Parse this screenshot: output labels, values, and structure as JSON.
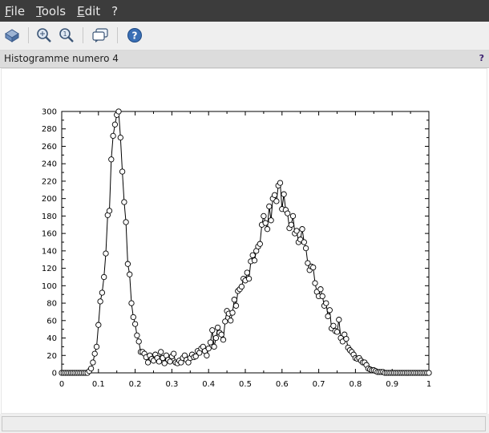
{
  "menu": [
    "File",
    "Tools",
    "Edit",
    "?"
  ],
  "toolbar": {
    "icons": [
      "select-rotate-icon",
      "zoom-icon",
      "zoom-reset-icon",
      "datatip-icon",
      "help-icon"
    ]
  },
  "panel": {
    "title": "Histogramme numero 4",
    "help": "?"
  },
  "chart_data": {
    "type": "line",
    "title": "",
    "xlabel": "",
    "ylabel": "",
    "xlim": [
      0,
      1
    ],
    "ylim": [
      0,
      300
    ],
    "x_ticks": [
      "0",
      "0.1",
      "0.2",
      "0.3",
      "0.4",
      "0.5",
      "0.6",
      "0.7",
      "0.8",
      "0.9",
      "1"
    ],
    "y_ticks": [
      "0",
      "20",
      "40",
      "60",
      "80",
      "100",
      "120",
      "140",
      "160",
      "180",
      "200",
      "220",
      "240",
      "260",
      "280",
      "300"
    ],
    "grid": false,
    "markers": "open-circle",
    "series": [
      {
        "x": [
          0.0,
          0.005,
          0.01,
          0.015,
          0.02,
          0.025,
          0.03,
          0.035,
          0.04,
          0.045,
          0.05,
          0.055,
          0.06,
          0.065,
          0.07,
          0.075,
          0.08,
          0.085,
          0.09,
          0.095,
          0.1,
          0.105,
          0.11,
          0.115,
          0.12,
          0.125,
          0.13,
          0.135,
          0.14,
          0.145,
          0.15,
          0.155,
          0.16,
          0.165,
          0.17,
          0.175,
          0.18,
          0.185,
          0.19,
          0.195,
          0.2,
          0.205,
          0.21,
          0.215,
          0.22,
          0.225,
          0.23,
          0.235,
          0.24,
          0.245,
          0.25,
          0.255,
          0.26,
          0.265,
          0.27,
          0.275,
          0.28,
          0.285,
          0.29,
          0.295,
          0.3,
          0.305,
          0.31,
          0.315,
          0.32,
          0.325,
          0.33,
          0.335,
          0.34,
          0.345,
          0.35,
          0.355,
          0.36,
          0.365,
          0.37,
          0.375,
          0.38,
          0.385,
          0.39,
          0.395,
          0.4,
          0.405,
          0.41,
          0.415,
          0.42,
          0.425,
          0.43,
          0.435,
          0.44,
          0.445,
          0.45,
          0.455,
          0.46,
          0.465,
          0.47,
          0.475,
          0.48,
          0.485,
          0.49,
          0.495,
          0.5,
          0.505,
          0.51,
          0.515,
          0.52,
          0.525,
          0.53,
          0.535,
          0.54,
          0.545,
          0.55,
          0.555,
          0.56,
          0.565,
          0.57,
          0.575,
          0.58,
          0.585,
          0.59,
          0.595,
          0.6,
          0.605,
          0.61,
          0.615,
          0.62,
          0.625,
          0.63,
          0.635,
          0.64,
          0.645,
          0.65,
          0.655,
          0.66,
          0.665,
          0.67,
          0.675,
          0.68,
          0.685,
          0.69,
          0.695,
          0.7,
          0.705,
          0.71,
          0.715,
          0.72,
          0.725,
          0.73,
          0.735,
          0.74,
          0.745,
          0.75,
          0.755,
          0.76,
          0.765,
          0.77,
          0.775,
          0.78,
          0.785,
          0.79,
          0.795,
          0.8,
          0.805,
          0.81,
          0.815,
          0.82,
          0.825,
          0.83,
          0.835,
          0.84,
          0.845,
          0.85,
          0.855,
          0.86,
          0.865,
          0.87,
          0.875,
          0.88,
          0.885,
          0.89,
          0.895,
          0.9,
          0.905,
          0.91,
          0.915,
          0.92,
          0.925,
          0.93,
          0.935,
          0.94,
          0.945,
          0.95,
          0.955,
          0.96,
          0.965,
          0.97,
          0.975,
          0.98,
          0.985,
          0.99,
          0.995,
          1.0
        ],
        "values": [
          0,
          0,
          0,
          0,
          0,
          0,
          0,
          0,
          0,
          0,
          0,
          0,
          0,
          0,
          0,
          2,
          5,
          12,
          22,
          30,
          55,
          82,
          92,
          110,
          137,
          181,
          186,
          245,
          272,
          285,
          296,
          300,
          270,
          231,
          196,
          173,
          125,
          113,
          80,
          64,
          56,
          43,
          36,
          24,
          24,
          22,
          18,
          12,
          20,
          16,
          14,
          21,
          17,
          13,
          24,
          17,
          11,
          20,
          15,
          13,
          19,
          22,
          12,
          11,
          14,
          12,
          17,
          20,
          15,
          12,
          17,
          21,
          18,
          19,
          25,
          23,
          28,
          30,
          25,
          20,
          28,
          35,
          49,
          30,
          40,
          52,
          46,
          44,
          38,
          59,
          71,
          68,
          60,
          69,
          84,
          77,
          94,
          96,
          99,
          108,
          106,
          115,
          108,
          128,
          135,
          129,
          140,
          145,
          148,
          170,
          180,
          172,
          165,
          191,
          175,
          200,
          204,
          197,
          215,
          218,
          188,
          205,
          187,
          183,
          166,
          170,
          180,
          160,
          163,
          150,
          153,
          165,
          150,
          143,
          126,
          118,
          122,
          121,
          103,
          93,
          88,
          96,
          88,
          77,
          80,
          65,
          72,
          51,
          54,
          48,
          47,
          61,
          40,
          36,
          44,
          39,
          29,
          26,
          24,
          21,
          17,
          16,
          17,
          14,
          12,
          12,
          9,
          5,
          4,
          3,
          3,
          2,
          1,
          1,
          1,
          1,
          0,
          0,
          0,
          0,
          0,
          0,
          0,
          0,
          0,
          0,
          0,
          0,
          0,
          0,
          0,
          0,
          0,
          0,
          0,
          0,
          0,
          0,
          0,
          0,
          0
        ]
      }
    ]
  }
}
